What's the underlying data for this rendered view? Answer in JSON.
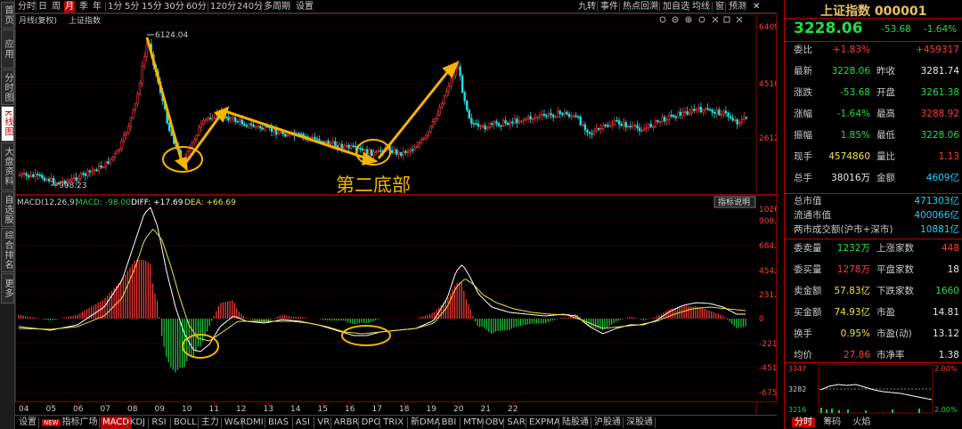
{
  "left_rail": [
    "首页",
    "应用",
    "分时图",
    "K线图",
    "大盘资料",
    "自选股",
    "综合排名",
    "更多"
  ],
  "toolbar": {
    "periods": [
      "分时",
      "日",
      "周",
      "月",
      "季",
      "年",
      "1分",
      "5分",
      "15分",
      "30分",
      "60分",
      "120分",
      "240分",
      "多周期",
      "设置"
    ],
    "active_period": "月",
    "right_items": [
      "九转",
      "事件",
      "热点回溯",
      "加自选",
      "均线",
      "窗",
      "预测"
    ]
  },
  "main_chart": {
    "label": "月线(复权)",
    "name": "上证指数",
    "high_label": "6124.04",
    "low_label": "998.23",
    "annotation": "第二底部",
    "y_ticks": [
      "6409",
      "4510",
      "2612"
    ]
  },
  "macd": {
    "title": "MACD(12,26,9)",
    "macd_text": "MACD: -98.00",
    "diff_text": "DIFF: +17.69",
    "dea_text": "DEA: +66.69",
    "help_label": "指标说明",
    "y_ticks": [
      "1026",
      "908.1",
      "684.6",
      "454.9",
      "231.4",
      "0",
      "-221.9",
      "-451.6",
      "-675.1"
    ]
  },
  "x_dates": [
    "04",
    "05",
    "06",
    "07",
    "08",
    "09",
    "10",
    "11",
    "12",
    "13",
    "14",
    "15",
    "16",
    "17",
    "18",
    "19",
    "20",
    "21",
    "22"
  ],
  "bottom_bar": {
    "items": [
      "设置",
      "指标广场",
      "MACD",
      "KDJ",
      "RSI",
      "BOLL",
      "主力",
      "W&R",
      "DMI",
      "BIAS",
      "ASI",
      "VR",
      "ARBR",
      "DPO",
      "TRIX",
      "新DMA",
      "BBI",
      "MTM",
      "OBV",
      "SAR",
      "EXPMA",
      "陆股通",
      "沪股通",
      "深股通"
    ],
    "new_badge": "NEW",
    "active": "MACD"
  },
  "quote": {
    "title": "上证指数 000001",
    "price": "3228.06",
    "change": "-53.68",
    "pct": "-1.64%",
    "rows": [
      {
        "l1": "委比",
        "v1": "+1.83%",
        "c1": "red",
        "l2": "",
        "v2": "+459317",
        "c2": "red"
      },
      {
        "l1": "最新",
        "v1": "3228.06",
        "c1": "green",
        "l2": "昨收",
        "v2": "3281.74",
        "c2": "white"
      },
      {
        "l1": "涨跌",
        "v1": "-53.68",
        "c1": "green",
        "l2": "开盘",
        "v2": "3261.38",
        "c2": "green"
      },
      {
        "l1": "涨幅",
        "v1": "-1.64%",
        "c1": "green",
        "l2": "最高",
        "v2": "3288.92",
        "c2": "red"
      },
      {
        "l1": "振幅",
        "v1": "1.85%",
        "c1": "green",
        "l2": "最低",
        "v2": "3228.06",
        "c2": "green"
      },
      {
        "l1": "现手",
        "v1": "4574860",
        "c1": "yellow",
        "l2": "量比",
        "v2": "1.13",
        "c2": "red"
      },
      {
        "l1": "总手",
        "v1": "38016万",
        "c1": "white",
        "l2": "金额",
        "v2": "4609亿",
        "c2": "cyan"
      }
    ],
    "mid_rows": [
      {
        "label": "总市值",
        "value": "471303亿"
      },
      {
        "label": "流通市值",
        "value": "400066亿"
      },
      {
        "label": "两市成交额(沪市+深市)",
        "value": "10881亿"
      }
    ],
    "rows2": [
      {
        "l1": "委卖量",
        "v1": "1232万",
        "c1": "green",
        "l2": "上涨家数",
        "v2": "448",
        "c2": "red"
      },
      {
        "l1": "委买量",
        "v1": "1278万",
        "c1": "red",
        "l2": "平盘家数",
        "v2": "18",
        "c2": "white"
      },
      {
        "l1": "卖金额",
        "v1": "57.83亿",
        "c1": "yellow",
        "l2": "下跌家数",
        "v2": "1660",
        "c2": "green"
      },
      {
        "l1": "买金额",
        "v1": "74.93亿",
        "c1": "yellow",
        "l2": "市盈",
        "v2": "14.81",
        "c2": "white"
      },
      {
        "l1": "换手",
        "v1": "0.95%",
        "c1": "yellow",
        "l2": "市盈(动)",
        "v2": "13.12",
        "c2": "white"
      },
      {
        "l1": "均价",
        "v1": "27.86",
        "c1": "red",
        "l2": "市净率",
        "v2": "1.38",
        "c2": "white"
      }
    ],
    "mini": {
      "top": "3347",
      "mid": "3282",
      "bot": "3216",
      "pct_top": "2.00%",
      "pct_bot": "2.00%"
    },
    "tabs": [
      "分时",
      "筹码",
      "火焰"
    ]
  },
  "colors": {
    "up": "#ff3b3b",
    "down": "#22e0e0",
    "macd_down": "#22cc44",
    "diff": "#ffffff",
    "dea": "#f0e040",
    "arrow": "#f5b400"
  }
}
